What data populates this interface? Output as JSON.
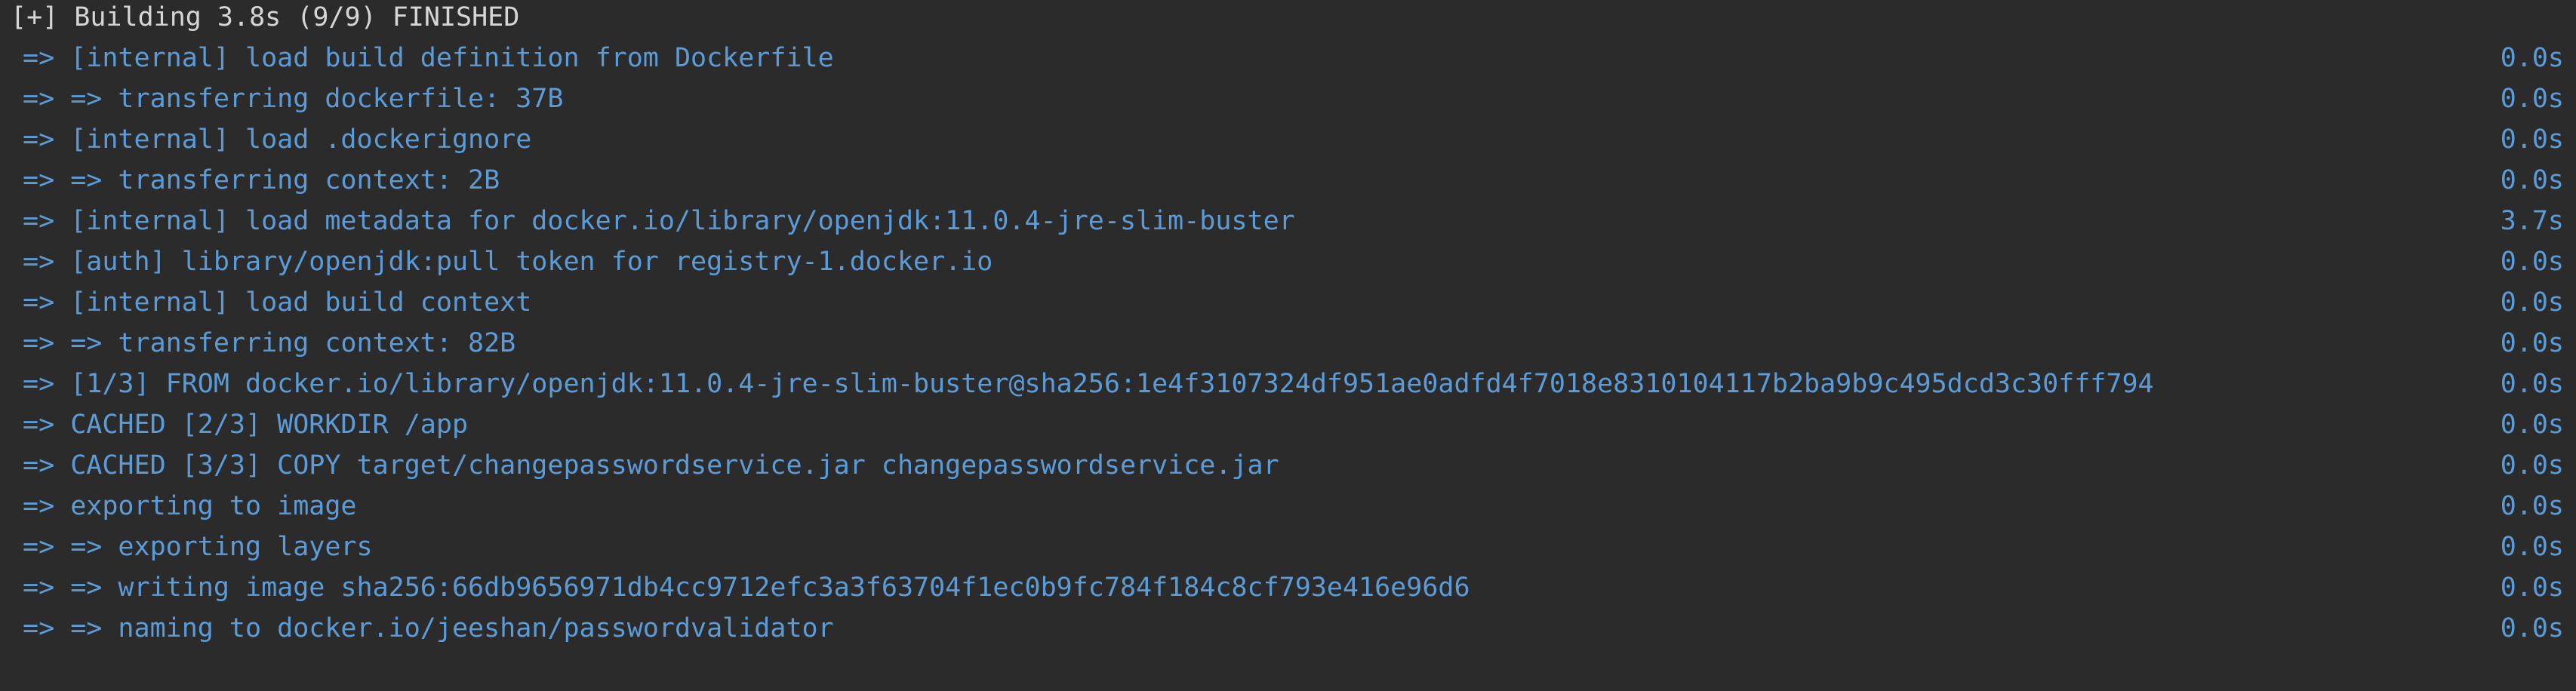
{
  "header": {
    "text": "[+] Building 3.8s (9/9) FINISHED"
  },
  "colors": {
    "background": "#2b2b2b",
    "header_text": "#d6d6d6",
    "log_text": "#5b9bd8"
  },
  "log": [
    {
      "text": "=> [internal] load build definition from Dockerfile",
      "time": "0.0s"
    },
    {
      "text": "=> => transferring dockerfile: 37B",
      "time": "0.0s"
    },
    {
      "text": "=> [internal] load .dockerignore",
      "time": "0.0s"
    },
    {
      "text": "=> => transferring context: 2B",
      "time": "0.0s"
    },
    {
      "text": "=> [internal] load metadata for docker.io/library/openjdk:11.0.4-jre-slim-buster",
      "time": "3.7s"
    },
    {
      "text": "=> [auth] library/openjdk:pull token for registry-1.docker.io",
      "time": "0.0s"
    },
    {
      "text": "=> [internal] load build context",
      "time": "0.0s"
    },
    {
      "text": "=> => transferring context: 82B",
      "time": "0.0s"
    },
    {
      "text": "=> [1/3] FROM docker.io/library/openjdk:11.0.4-jre-slim-buster@sha256:1e4f3107324df951ae0adfd4f7018e8310104117b2ba9b9c495dcd3c30fff794",
      "time": "0.0s"
    },
    {
      "text": "=> CACHED [2/3] WORKDIR /app",
      "time": "0.0s"
    },
    {
      "text": "=> CACHED [3/3] COPY target/changepasswordservice.jar changepasswordservice.jar",
      "time": "0.0s"
    },
    {
      "text": "=> exporting to image",
      "time": "0.0s"
    },
    {
      "text": "=> => exporting layers",
      "time": "0.0s"
    },
    {
      "text": "=> => writing image sha256:66db9656971db4cc9712efc3a3f63704f1ec0b9fc784f184c8cf793e416e96d6",
      "time": "0.0s"
    },
    {
      "text": "=> => naming to docker.io/jeeshan/passwordvalidator",
      "time": "0.0s"
    }
  ]
}
